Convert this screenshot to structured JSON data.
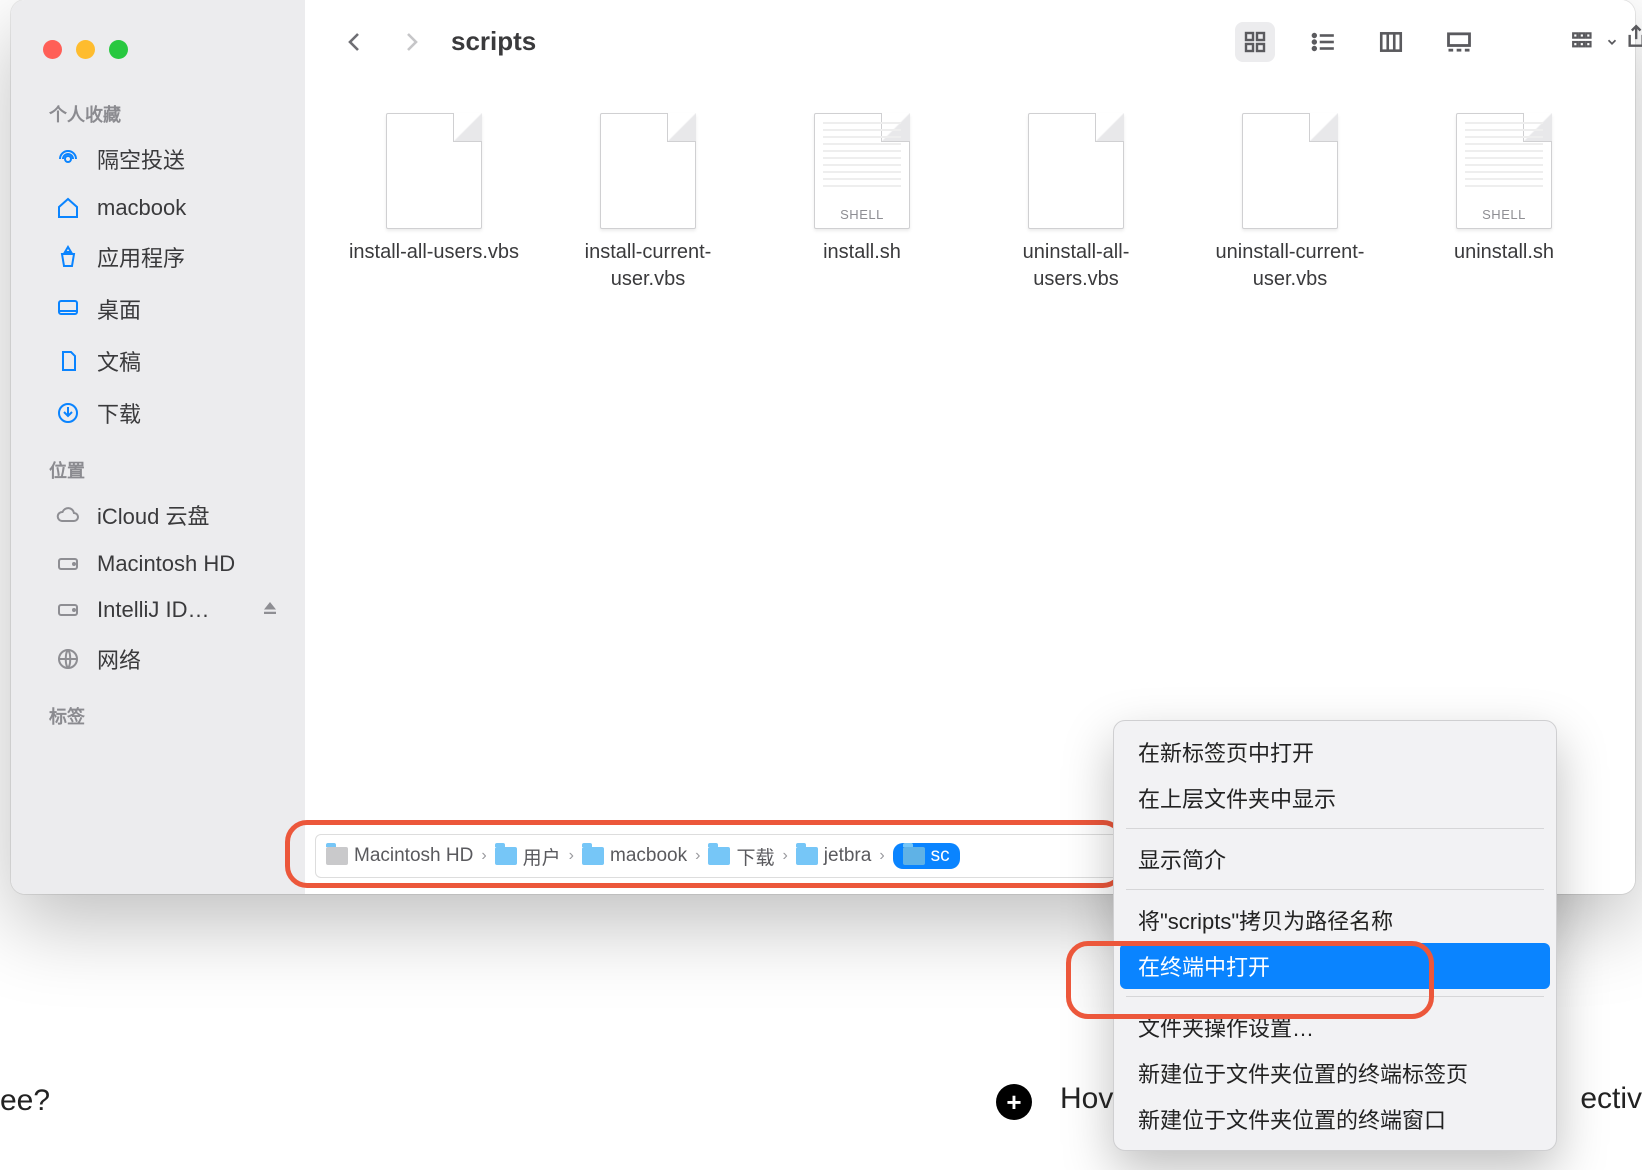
{
  "window": {
    "title": "scripts"
  },
  "sidebar": {
    "sections": [
      {
        "title": "个人收藏",
        "items": [
          {
            "label": "隔空投送",
            "icon": "airdrop-icon"
          },
          {
            "label": "macbook",
            "icon": "house-icon"
          },
          {
            "label": "应用程序",
            "icon": "apps-icon"
          },
          {
            "label": "桌面",
            "icon": "desktop-icon"
          },
          {
            "label": "文稿",
            "icon": "document-icon"
          },
          {
            "label": "下载",
            "icon": "download-icon"
          }
        ]
      },
      {
        "title": "位置",
        "items": [
          {
            "label": "iCloud 云盘",
            "icon": "cloud-icon"
          },
          {
            "label": "Macintosh HD",
            "icon": "disk-icon"
          },
          {
            "label": "IntelliJ ID…",
            "icon": "disk-icon",
            "eject": true
          },
          {
            "label": "网络",
            "icon": "network-icon"
          }
        ]
      },
      {
        "title": "标签",
        "items": []
      }
    ]
  },
  "files": [
    {
      "label": "install-all-users.vbs",
      "kind": "plain"
    },
    {
      "label": "install-current-user.vbs",
      "kind": "plain"
    },
    {
      "label": "install.sh",
      "kind": "shell",
      "tag": "SHELL"
    },
    {
      "label": "uninstall-all-users.vbs",
      "kind": "plain"
    },
    {
      "label": "uninstall-current-user.vbs",
      "kind": "plain"
    },
    {
      "label": "uninstall.sh",
      "kind": "shell",
      "tag": "SHELL"
    }
  ],
  "path": [
    {
      "label": "Macintosh HD",
      "type": "hd"
    },
    {
      "label": "用户",
      "type": "folder"
    },
    {
      "label": "macbook",
      "type": "folder"
    },
    {
      "label": "下载",
      "type": "folder"
    },
    {
      "label": "jetbra",
      "type": "folder"
    },
    {
      "label": "sc",
      "type": "folder",
      "selected": true
    }
  ],
  "context_menu": {
    "groups": [
      [
        "在新标签页中打开",
        "在上层文件夹中显示"
      ],
      [
        "显示简介"
      ],
      [
        "将\"scripts\"拷贝为路径名称",
        "在终端中打开"
      ],
      [
        "文件夹操作设置…",
        "新建位于文件夹位置的终端标签页",
        "新建位于文件夹位置的终端窗口"
      ]
    ],
    "highlighted": "在终端中打开"
  },
  "bg": {
    "left": "ee?",
    "mid": "Hov",
    "right": "ectiv"
  }
}
